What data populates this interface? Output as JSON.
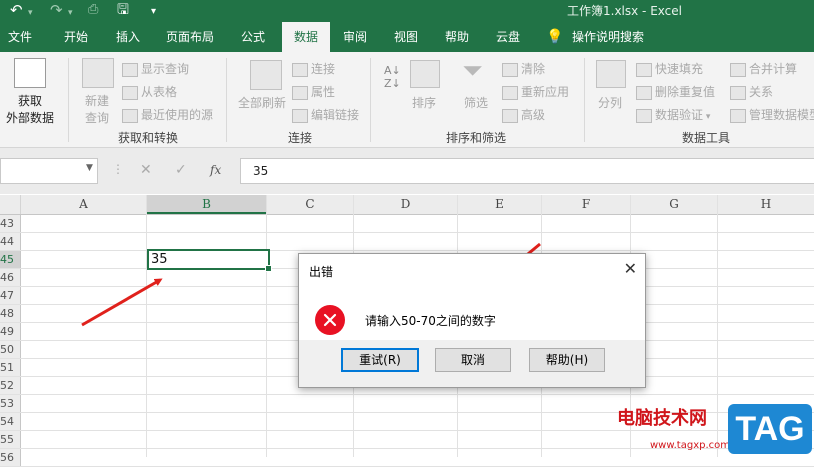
{
  "window": {
    "title": "工作簿1.xlsx  -  Excel",
    "qa_undo": "↶",
    "qa_redo": "↷",
    "qa_save": "🖫",
    "qa_more": "▾"
  },
  "tabs": [
    "文件",
    "开始",
    "插入",
    "页面布局",
    "公式",
    "数据",
    "审阅",
    "视图",
    "帮助",
    "云盘"
  ],
  "active_tab": "数据",
  "tell_me": "操作说明搜索",
  "ribbon": {
    "get_external": [
      "获取",
      "外部数据"
    ],
    "new_query": [
      "新建",
      "查询"
    ],
    "show_queries": "显示查询",
    "from_table": "从表格",
    "recent_sources": "最近使用的源",
    "group_get_transform": "获取和转换",
    "refresh_all": "全部刷新",
    "connections": "连接",
    "properties": "属性",
    "edit_links": "编辑链接",
    "group_connections": "连接",
    "sort_az": "A↓Z",
    "sort": "排序",
    "filter": "筛选",
    "clear": "清除",
    "reapply": "重新应用",
    "advanced": "高级",
    "group_sort_filter": "排序和筛选",
    "text_to_columns": "分列",
    "flash_fill": "快速填充",
    "remove_duplicates": "删除重复值",
    "data_validation": "数据验证",
    "consolidate": "合并计算",
    "relationships": "关系",
    "manage_model": "管理数据模型",
    "group_data_tools": "数据工具"
  },
  "formula_bar": {
    "cancel": "✕",
    "enter": "✓",
    "fx": "fx",
    "value": "35"
  },
  "columns": [
    "A",
    "B",
    "C",
    "D",
    "E",
    "F",
    "G",
    "H"
  ],
  "selected_column": "B",
  "rows": [
    "43",
    "44",
    "45",
    "46",
    "47",
    "48",
    "49",
    "50",
    "51",
    "52",
    "53",
    "54",
    "55",
    "56"
  ],
  "selected_row": "45",
  "active_cell": {
    "ref": "B45",
    "value": "35"
  },
  "dialog": {
    "title": "出错",
    "message": "请输入50-70之间的数字",
    "buttons": [
      "重试(R)",
      "取消",
      "帮助(H)"
    ],
    "default_button": "重试(R)",
    "accent_color": "#0078d7",
    "error_color": "#e81123"
  },
  "colors": {
    "excel_green": "#217346",
    "annotation_red": "#e0211c"
  },
  "watermark": {
    "text": "电脑技术网",
    "tag": "TAG",
    "url": "www.tagxp.com"
  }
}
